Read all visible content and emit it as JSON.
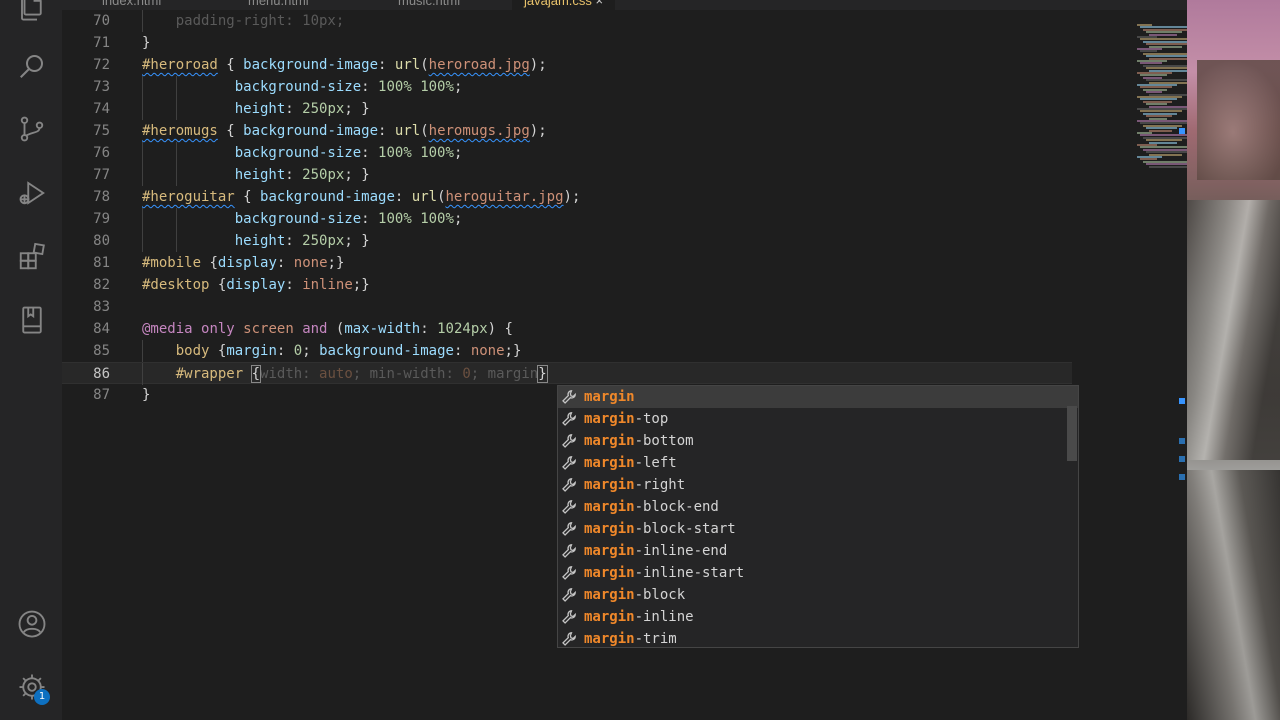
{
  "tabs": [
    {
      "label": "index.html",
      "active": false
    },
    {
      "label": "menu.html",
      "active": false
    },
    {
      "label": "music.html",
      "active": false
    },
    {
      "label": "javajam.css",
      "active": true,
      "close": "×"
    }
  ],
  "lines": [
    {
      "n": "70",
      "code": "    padding-right: 10px;"
    },
    {
      "n": "71",
      "code": "}"
    },
    {
      "n": "72",
      "code": "#heroroad { background-image: url(heroroad.jpg);"
    },
    {
      "n": "73",
      "code": "           background-size: 100% 100%;"
    },
    {
      "n": "74",
      "code": "           height: 250px; }"
    },
    {
      "n": "75",
      "code": "#heromugs { background-image: url(heromugs.jpg);"
    },
    {
      "n": "76",
      "code": "           background-size: 100% 100%;"
    },
    {
      "n": "77",
      "code": "           height: 250px; }"
    },
    {
      "n": "78",
      "code": "#heroguitar { background-image: url(heroguitar.jpg);"
    },
    {
      "n": "79",
      "code": "           background-size: 100% 100%;"
    },
    {
      "n": "80",
      "code": "           height: 250px; }"
    },
    {
      "n": "81",
      "code": "#mobile {display: none;}"
    },
    {
      "n": "82",
      "code": "#desktop {display: inline;}"
    },
    {
      "n": "83",
      "code": ""
    },
    {
      "n": "84",
      "code": "@media only screen and (max-width: 1024px) {"
    },
    {
      "n": "85",
      "code": "    body {margin: 0; background-image: none;}"
    },
    {
      "n": "86",
      "code": "    #wrapper {width: auto; min-width: 0; margin}"
    },
    {
      "n": "87",
      "code": "}"
    }
  ],
  "suggestions": {
    "typed_prefix": "margin",
    "items": [
      {
        "hl": "margin",
        "rest": ""
      },
      {
        "hl": "margin",
        "rest": "-top"
      },
      {
        "hl": "margin",
        "rest": "-bottom"
      },
      {
        "hl": "margin",
        "rest": "-left"
      },
      {
        "hl": "margin",
        "rest": "-right"
      },
      {
        "hl": "margin",
        "rest": "-block-end"
      },
      {
        "hl": "margin",
        "rest": "-block-start"
      },
      {
        "hl": "margin",
        "rest": "-inline-end"
      },
      {
        "hl": "margin",
        "rest": "-inline-start"
      },
      {
        "hl": "margin",
        "rest": "-block"
      },
      {
        "hl": "margin",
        "rest": "-inline"
      },
      {
        "hl": "margin",
        "rest": "-trim"
      }
    ],
    "selected_index": 0,
    "item_icon": "wrench-icon"
  },
  "activity_bar": {
    "icons": [
      "explorer-icon",
      "search-icon",
      "source-control-icon",
      "run-debug-icon",
      "extensions-icon",
      "bookmark-icon",
      "account-icon",
      "settings-gear-icon"
    ],
    "settings_badge": "1"
  },
  "colors": {
    "editor_bg": "#1e1e1e",
    "selector": "#d7ba7d",
    "property": "#9cdcfe",
    "number": "#b5cea8",
    "string_value": "#ce9178",
    "keyword": "#c586c0",
    "suggest_highlight": "#f0882a",
    "badge": "#0e70c0"
  }
}
